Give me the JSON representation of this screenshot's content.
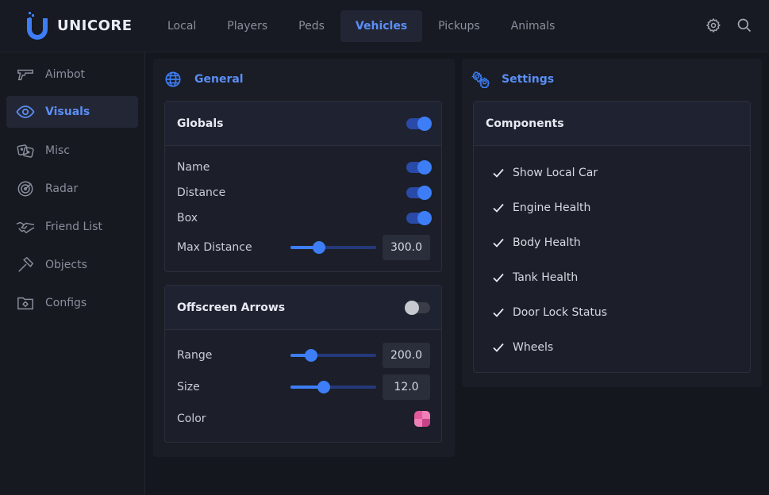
{
  "app": {
    "name": "UNICORE"
  },
  "tabs": [
    {
      "label": "Local"
    },
    {
      "label": "Players"
    },
    {
      "label": "Peds"
    },
    {
      "label": "Vehicles",
      "active": true
    },
    {
      "label": "Pickups"
    },
    {
      "label": "Animals"
    }
  ],
  "sidebar": {
    "items": [
      {
        "label": "Aimbot",
        "icon": "gun-icon"
      },
      {
        "label": "Visuals",
        "icon": "eye-icon",
        "active": true
      },
      {
        "label": "Misc",
        "icon": "dice-icon"
      },
      {
        "label": "Radar",
        "icon": "radar-icon"
      },
      {
        "label": "Friend List",
        "icon": "handshake-icon"
      },
      {
        "label": "Objects",
        "icon": "hammer-icon"
      },
      {
        "label": "Configs",
        "icon": "folder-gear-icon"
      }
    ]
  },
  "general": {
    "title": "General",
    "globals": {
      "title": "Globals",
      "enabled": true,
      "name_label": "Name",
      "name_on": true,
      "distance_label": "Distance",
      "distance_on": true,
      "box_label": "Box",
      "box_on": true,
      "max_distance_label": "Max Distance",
      "max_distance_value": "300.0",
      "max_distance_fraction": 0.33
    },
    "offscreen": {
      "title": "Offscreen Arrows",
      "enabled": false,
      "range_label": "Range",
      "range_value": "200.0",
      "range_fraction": 0.24,
      "size_label": "Size",
      "size_value": "12.0",
      "size_fraction": 0.39,
      "color_label": "Color",
      "colors": [
        "#e35a9c",
        "#f07fb8",
        "#f07fb8",
        "#c74387"
      ]
    }
  },
  "settings": {
    "title": "Settings",
    "components": {
      "title": "Components",
      "items": [
        {
          "label": "Show Local Car",
          "checked": true
        },
        {
          "label": "Engine Health",
          "checked": true
        },
        {
          "label": "Body Health",
          "checked": true
        },
        {
          "label": "Tank Health",
          "checked": true
        },
        {
          "label": "Door Lock Status",
          "checked": true
        },
        {
          "label": "Wheels",
          "checked": true
        }
      ]
    }
  },
  "accent": "#3d7ef6"
}
